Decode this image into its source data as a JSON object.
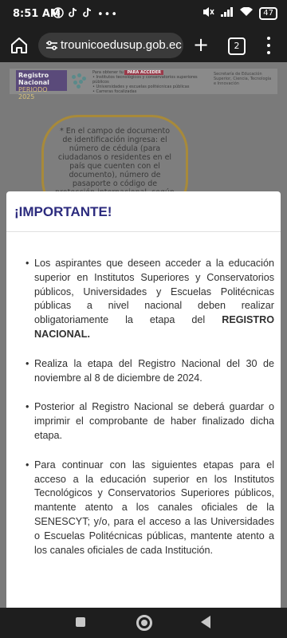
{
  "status_bar": {
    "time": "8:51 AM",
    "battery": "47"
  },
  "browser": {
    "url": "trounicoedusup.gob.ec",
    "tab_count": "2",
    "new_tab_label": "+"
  },
  "banner": {
    "brand_line1": "Registro Nacional",
    "brand_line2": "PERIODO 2025",
    "tag": "PARA ACCEDER",
    "intro": "Para obtener tu",
    "line1": "• Institutos tecnológicos y conservatorios superiores públicos",
    "line2": "• Universidades y escuelas politécnicas públicas",
    "line3": "• Carreras focalizadas",
    "right_text": "Secretaría de Educación Superior, Ciencia, Tecnología e Innovación"
  },
  "bubble_text": "* En el campo de documento de identificación ingresa: el número de cédula (para ciudadanos o residentes en el país que cuenten con el documento), número de pasaporte o código de protección internacional, según corresponda. Digita la información sin espacios ni líneas de separación.",
  "modal": {
    "title": "¡IMPORTANTE!",
    "item1_text": "Los aspirantes que deseen acceder a la educación superior en Institutos Superiores y Conservatorios públicos, Universidades y Escuelas Politécnicas públicas a nivel nacional deben realizar obligatoriamente la etapa del ",
    "item1_bold": "REGISTRO NACIONAL.",
    "item2": "Realiza la etapa del Registro Nacional del 30 de noviembre al 8 de diciembre de 2024.",
    "item3": "Posterior al Registro Nacional se deberá guardar o imprimir el comprobante de haber finalizado dicha etapa.",
    "item4": "Para continuar con las siguientes etapas para el acceso a la educación superior en los Institutos Tecnológicos y Conservatorios Superiores públicos, mantente atento a los canales oficiales de la SENESCYT; y/o, para el acceso a las Universidades o Escuelas Politécnicas públicas, mantente atento a los canales oficiales de cada Institución."
  },
  "colors": {
    "title": "#2c2b7e",
    "bubble_border": "#a88a3a",
    "overlay": "#7a7a7a"
  }
}
